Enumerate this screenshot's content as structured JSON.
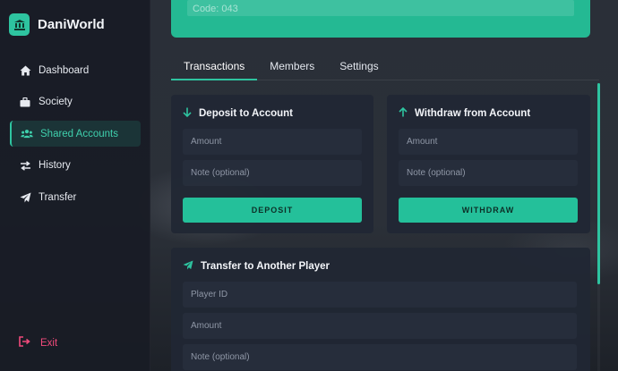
{
  "app": {
    "name": "DaniWorld"
  },
  "sidebar": {
    "items": [
      {
        "label": "Dashboard",
        "icon": "home-icon"
      },
      {
        "label": "Society",
        "icon": "briefcase-icon"
      },
      {
        "label": "Shared Accounts",
        "icon": "users-icon",
        "active": true
      },
      {
        "label": "History",
        "icon": "exchange-icon"
      },
      {
        "label": "Transfer",
        "icon": "send-icon"
      }
    ],
    "exit_label": "Exit"
  },
  "banner": {
    "code_text": "Code: 043"
  },
  "tabs": [
    {
      "label": "Transactions",
      "active": true
    },
    {
      "label": "Members"
    },
    {
      "label": "Settings"
    }
  ],
  "deposit": {
    "title": "Deposit to Account",
    "amount_placeholder": "Amount",
    "note_placeholder": "Note (optional)",
    "button_label": "DEPOSIT"
  },
  "withdraw": {
    "title": "Withdraw from Account",
    "amount_placeholder": "Amount",
    "note_placeholder": "Note (optional)",
    "button_label": "WITHDRAW"
  },
  "transfer": {
    "title": "Transfer to Another Player",
    "player_id_placeholder": "Player ID",
    "amount_placeholder": "Amount",
    "note_placeholder": "Note (optional)"
  },
  "colors": {
    "accent": "#2ec4a0",
    "exit": "#f04a7b",
    "background": "#171c26"
  }
}
